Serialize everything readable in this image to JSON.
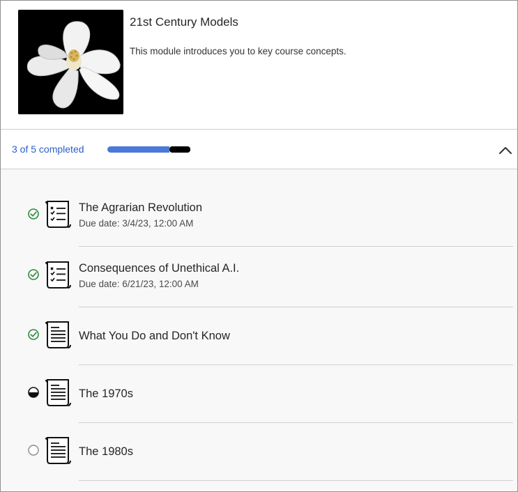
{
  "module": {
    "title": "21st Century Models",
    "description": "This module introduces you to key course concepts.",
    "thumbnail_icon": "magnolia-flower-image"
  },
  "progress": {
    "text": "3 of 5 completed",
    "completed": 3,
    "in_progress": 1,
    "total": 5,
    "colors": {
      "completed": "#4b79d9",
      "in_progress": "#000000",
      "remaining": "#9a9a9a"
    },
    "collapse_icon": "chevron-up-icon"
  },
  "items": [
    {
      "title": "The Agrarian Revolution",
      "due": "Due date: 3/4/23, 12:00 AM",
      "status": "completed",
      "icon": "checklist-icon"
    },
    {
      "title": "Consequences of Unethical A.I.",
      "due": "Due date: 6/21/23, 12:00 AM",
      "status": "completed",
      "icon": "checklist-icon"
    },
    {
      "title": "What You Do and Don't Know",
      "due": "",
      "status": "completed",
      "icon": "document-icon"
    },
    {
      "title": "The 1970s",
      "due": "",
      "status": "in-progress",
      "icon": "document-icon"
    },
    {
      "title": "The 1980s",
      "due": "",
      "status": "not-started",
      "icon": "document-icon"
    }
  ]
}
